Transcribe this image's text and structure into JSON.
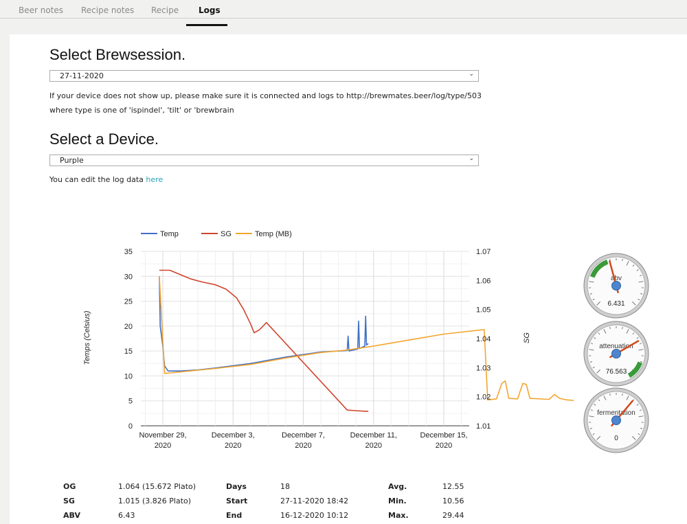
{
  "tabs": [
    "Beer notes",
    "Recipe notes",
    "Recipe",
    "Logs"
  ],
  "session": {
    "heading": "Select Brewsession.",
    "selected": "27-11-2020",
    "help_line1": "If your device does not show up, please make sure it is connected and logs to http://brewmates.beer/log/type/503",
    "help_line2": "where type is one of 'ispindel', 'tilt' or 'brewbrain"
  },
  "device": {
    "heading": "Select a Device.",
    "selected": "Purple",
    "edit_text": "You can edit the log data ",
    "edit_link": "here"
  },
  "chart_data": {
    "type": "line",
    "legend": [
      "Temp",
      "SG",
      "Temp (MB)"
    ],
    "legend_position": "top",
    "ylabel_left": "Temps (Celsius)",
    "ylabel_right": "SG",
    "y_left_ticks": [
      "35",
      "30",
      "25",
      "20",
      "15",
      "10",
      "5",
      "0"
    ],
    "y_right_ticks": [
      "1.07",
      "1.06",
      "1.05",
      "1.04",
      "1.03",
      "1.02",
      "1.01"
    ],
    "ylim_left": [
      0,
      35
    ],
    "ylim_right": [
      1.01,
      1.07
    ],
    "x_ticks": [
      {
        "line1": "November 29,",
        "line2": "2020"
      },
      {
        "line1": "December 3,",
        "line2": "2020"
      },
      {
        "line1": "December 7,",
        "line2": "2020"
      },
      {
        "line1": "December 11,",
        "line2": "2020"
      },
      {
        "line1": "December 15,",
        "line2": "2020"
      }
    ],
    "grid": true,
    "series_x_days_since_nov27": true,
    "series": [
      {
        "name": "Temp",
        "color": "#3f6fc5",
        "axis": "left",
        "points": [
          [
            1.8,
            30
          ],
          [
            1.85,
            20
          ],
          [
            2.0,
            16
          ],
          [
            2.1,
            12
          ],
          [
            2.3,
            11
          ],
          [
            3.0,
            11
          ],
          [
            4.0,
            11.2
          ],
          [
            5.0,
            11.6
          ],
          [
            7.0,
            12.5
          ],
          [
            9.0,
            13.8
          ],
          [
            11.0,
            14.8
          ],
          [
            12.5,
            15.1
          ],
          [
            12.55,
            18
          ],
          [
            12.6,
            15
          ],
          [
            13.1,
            15.4
          ],
          [
            13.15,
            21
          ],
          [
            13.2,
            15.5
          ],
          [
            13.5,
            16
          ],
          [
            13.55,
            22
          ],
          [
            13.6,
            16.2
          ],
          [
            13.7,
            16.5
          ]
        ]
      },
      {
        "name": "SG",
        "color": "#d0442c",
        "axis": "right",
        "points": [
          [
            1.8,
            1.0635
          ],
          [
            2.4,
            1.0635
          ],
          [
            3.0,
            1.062
          ],
          [
            3.6,
            1.0605
          ],
          [
            4.2,
            1.0595
          ],
          [
            5.0,
            1.0585
          ],
          [
            5.6,
            1.057
          ],
          [
            6.2,
            1.054
          ],
          [
            6.6,
            1.05
          ],
          [
            7.0,
            1.045
          ],
          [
            7.2,
            1.042
          ],
          [
            7.5,
            1.043
          ],
          [
            7.9,
            1.0455
          ],
          [
            12.5,
            1.0154
          ],
          [
            13.0,
            1.0152
          ],
          [
            13.5,
            1.015
          ],
          [
            13.7,
            1.015
          ]
        ]
      },
      {
        "name": "Temp (MB)",
        "color": "#f4a52f",
        "axis": "left",
        "points": [
          [
            1.8,
            30
          ],
          [
            2.1,
            10.5
          ],
          [
            3.0,
            10.8
          ],
          [
            5.0,
            11.5
          ],
          [
            7.0,
            12.3
          ],
          [
            9.0,
            13.6
          ],
          [
            11.0,
            14.7
          ],
          [
            12.5,
            15.2
          ],
          [
            14.0,
            16.0
          ],
          [
            16.0,
            17.2
          ],
          [
            18.0,
            18.4
          ],
          [
            20.0,
            19.2
          ],
          [
            20.3,
            19.3
          ],
          [
            20.5,
            5.2
          ],
          [
            21.0,
            5.4
          ],
          [
            21.3,
            8.5
          ],
          [
            21.5,
            9
          ],
          [
            21.7,
            5.5
          ],
          [
            22.2,
            5.4
          ],
          [
            22.5,
            8.5
          ],
          [
            22.7,
            8.3
          ],
          [
            22.9,
            5.5
          ],
          [
            24.0,
            5.3
          ],
          [
            24.3,
            6.3
          ],
          [
            24.6,
            5.5
          ],
          [
            25.0,
            5.2
          ],
          [
            25.4,
            5.1
          ]
        ]
      }
    ]
  },
  "gauges": [
    {
      "label": "abv",
      "value": "6.431"
    },
    {
      "label": "attenuation",
      "value": "76.563"
    },
    {
      "label": "fermentation",
      "value": "0"
    }
  ],
  "stats": {
    "col1": [
      {
        "label": "OG",
        "value": "1.064 (15.672 Plato)"
      },
      {
        "label": "SG",
        "value": "1.015 (3.826 Plato)"
      },
      {
        "label": "ABV",
        "value": "6.43"
      }
    ],
    "col2": [
      {
        "label": "Days",
        "value": "18"
      },
      {
        "label": "Start",
        "value": "27-11-2020 18:42"
      },
      {
        "label": "End",
        "value": "16-12-2020 10:12"
      }
    ],
    "col3": [
      {
        "label": "Avg.",
        "value": "12.55"
      },
      {
        "label": "Min.",
        "value": "10.56"
      },
      {
        "label": "Max.",
        "value": "29.44"
      }
    ]
  }
}
